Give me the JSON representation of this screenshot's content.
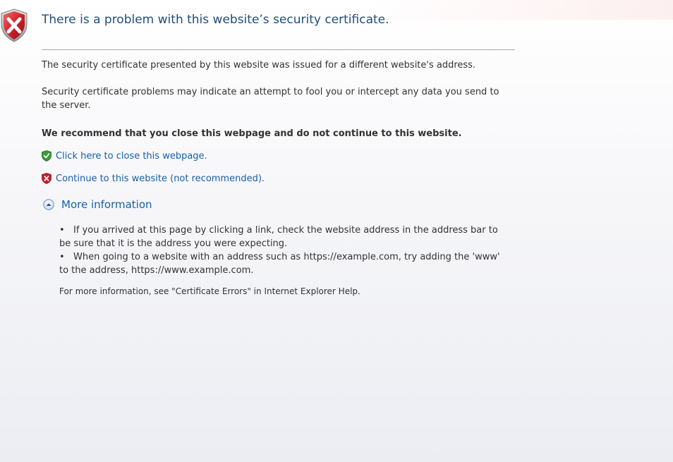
{
  "header": {
    "title": "There is a problem with this website’s security certificate."
  },
  "body": {
    "para1": "The security certificate presented by this website was issued for a different website's address.",
    "para2": "Security certificate problems may indicate an attempt to fool you or intercept any data you send to the server.",
    "recommendation": "We recommend that you close this webpage and do not continue to this website."
  },
  "links": {
    "close_label": "Click here to close this webpage.",
    "continue_label": "Continue to this website (not recommended)."
  },
  "more_info": {
    "label": "More information",
    "bullet": "•",
    "items": [
      "If you arrived at this page by clicking a link, check the website address in the address bar to be sure that it is the address you were expecting.",
      "When going to a website with an address such as https://example.com, try adding the 'www' to the address, https://www.example.com."
    ],
    "help_text": "For more information, see \"Certificate Errors\" in Internet Explorer Help."
  },
  "colors": {
    "title": "#1f4e79",
    "link": "#1560a8",
    "text": "#333333",
    "shield_red": "#c8202a",
    "shield_green": "#3a9a3a"
  },
  "icons": {
    "header": "red-shield-x-icon",
    "close": "green-shield-check-icon",
    "continue": "red-shield-x-icon",
    "expand": "chevron-up-circle-icon"
  }
}
